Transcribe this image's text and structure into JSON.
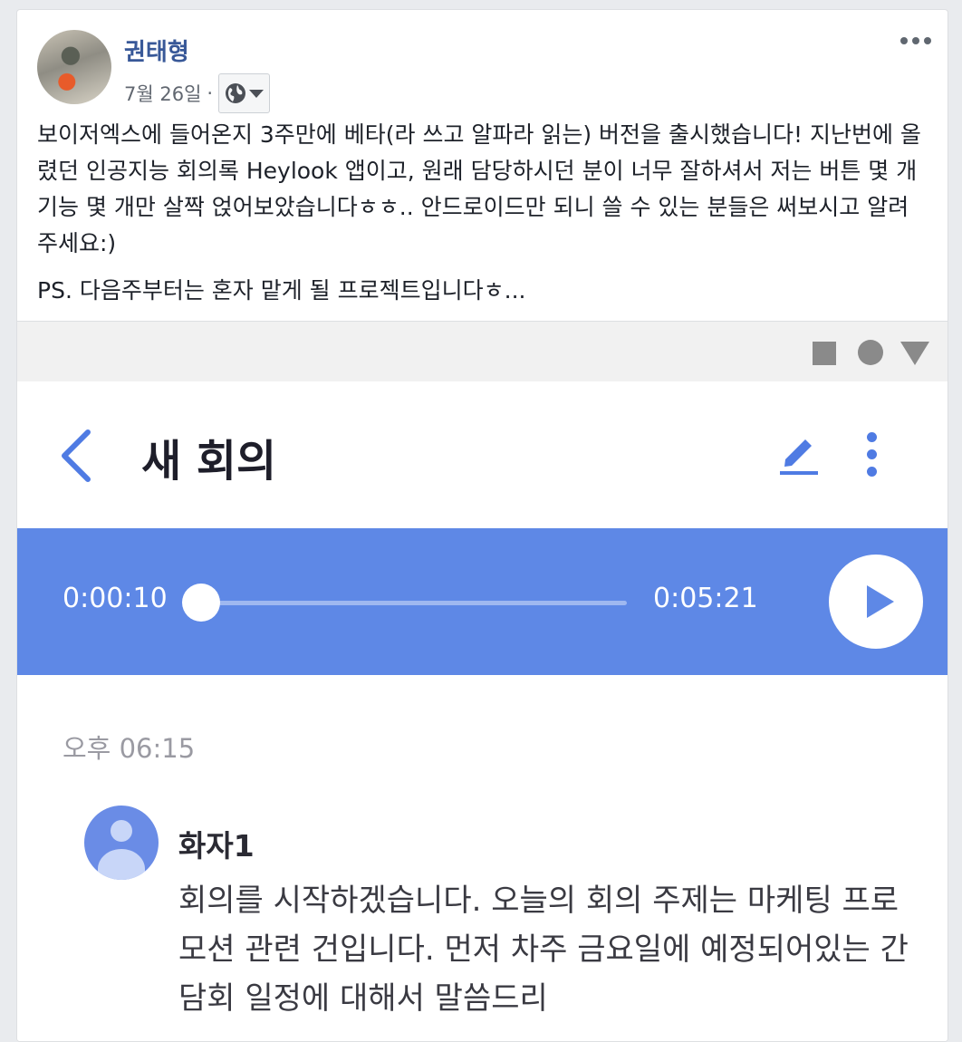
{
  "post": {
    "author": "권태형",
    "date": "7월 26일",
    "separator": "·",
    "paragraphs": [
      "보이저엑스에 들어온지 3주만에 베타(라 쓰고 알파라 읽는) 버전을 출시했습니다! 지난번에 올렸던 인공지능 회의록 Heylook 앱이고, 원래 담당하시던 분이 너무 잘하셔서 저는 버튼 몇 개 기능 몇 개만 살짝 얹어보았습니다ㅎㅎ.. 안드로이드만 되니 쓸 수 있는 분들은 써보시고 알려주세요:)",
      "PS. 다음주부터는 혼자 맡게 될 프로젝트입니다ㅎ..."
    ],
    "icons": {
      "audience": "globe-icon",
      "audience_caret": "caret-down-icon",
      "more": "more-horizontal-icon"
    }
  },
  "screenshot": {
    "app_title": "새 회의",
    "icons": {
      "back": "chevron-left-icon",
      "edit": "pencil-icon",
      "menu": "more-vertical-icon",
      "play": "play-icon",
      "nav_recents": "square-icon",
      "nav_home": "circle-icon",
      "nav_back": "triangle-icon"
    },
    "player": {
      "current_time": "0:00:10",
      "total_time": "0:05:21",
      "progress": 0.031
    },
    "transcript": {
      "timestamp": "오후 06:15",
      "speaker": "화자1",
      "text": "회의를 시작하겠습니다. 오늘의 회의 주제는 마케팅 프로모션 관련 건입니다. 먼저 차주 금요일에 예정되어있는 간담회 일정에 대해서 말씀드리"
    },
    "colors": {
      "accent": "#5e88e6",
      "link": "#385898"
    }
  }
}
